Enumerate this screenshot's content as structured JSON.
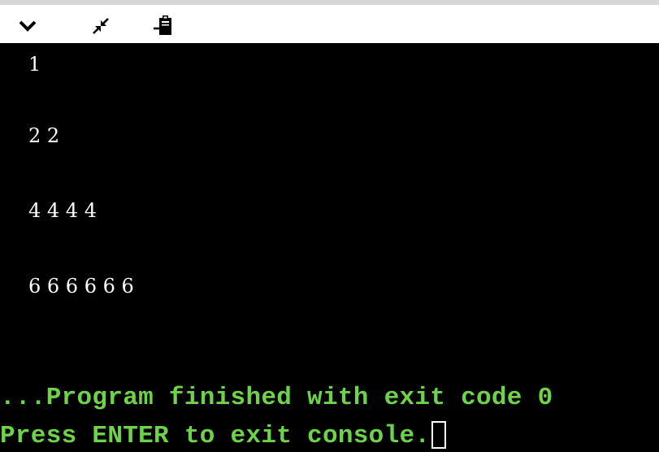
{
  "toolbar": {
    "buttons": [
      {
        "icon": "chevron-down-icon"
      },
      {
        "icon": "minimize-arrows-icon"
      },
      {
        "icon": "clipboard-paste-icon"
      }
    ]
  },
  "console": {
    "output_lines": [
      "1",
      "2 2",
      "4 4 4 4",
      "6 6 6 6 6 6"
    ],
    "status": {
      "finished": "...Program finished with exit code 0",
      "prompt": "Press ENTER to exit console."
    }
  },
  "colors": {
    "console_background": "#000000",
    "output_text": "#ffffff",
    "status_text": "#6ed24a"
  }
}
